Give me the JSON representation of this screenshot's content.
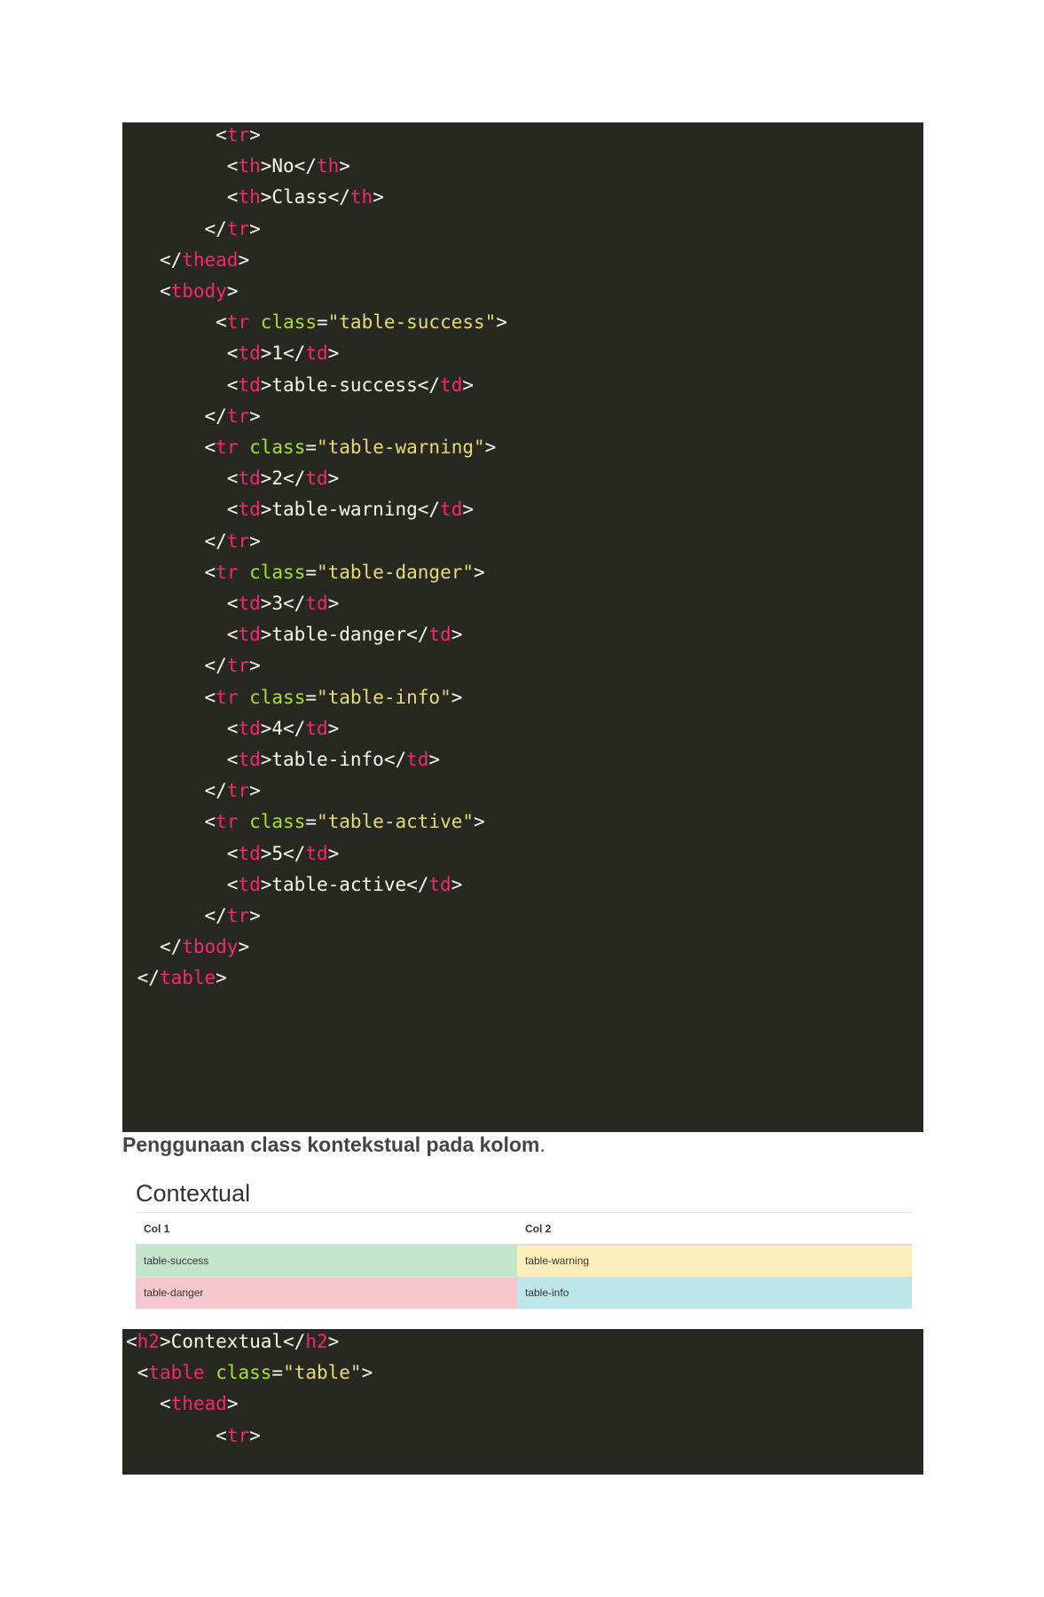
{
  "code_top": [
    {
      "indent": "        ",
      "tokens": [
        [
          "p",
          "<"
        ],
        [
          "t",
          "tr"
        ],
        [
          "p",
          ">"
        ]
      ]
    },
    {
      "indent": "         ",
      "tokens": [
        [
          "p",
          "<"
        ],
        [
          "t",
          "th"
        ],
        [
          "p",
          ">No</"
        ],
        [
          "t",
          "th"
        ],
        [
          "p",
          ">"
        ]
      ]
    },
    {
      "indent": "         ",
      "tokens": [
        [
          "p",
          "<"
        ],
        [
          "t",
          "th"
        ],
        [
          "p",
          ">Class</"
        ],
        [
          "t",
          "th"
        ],
        [
          "p",
          ">"
        ]
      ]
    },
    {
      "indent": "       ",
      "tokens": [
        [
          "p",
          "</"
        ],
        [
          "t",
          "tr"
        ],
        [
          "p",
          ">"
        ]
      ]
    },
    {
      "indent": "   ",
      "tokens": [
        [
          "p",
          "</"
        ],
        [
          "t",
          "thead"
        ],
        [
          "p",
          ">"
        ]
      ]
    },
    {
      "indent": "   ",
      "tokens": [
        [
          "p",
          "<"
        ],
        [
          "t",
          "tbody"
        ],
        [
          "p",
          ">"
        ]
      ]
    },
    {
      "indent": "        ",
      "tokens": [
        [
          "p",
          "<"
        ],
        [
          "t",
          "tr"
        ],
        [
          "p",
          " "
        ],
        [
          "a",
          "class"
        ],
        [
          "p",
          "="
        ],
        [
          "s",
          "\"table-success\""
        ],
        [
          "p",
          ">"
        ]
      ]
    },
    {
      "indent": "         ",
      "tokens": [
        [
          "p",
          "<"
        ],
        [
          "t",
          "td"
        ],
        [
          "p",
          ">1</"
        ],
        [
          "t",
          "td"
        ],
        [
          "p",
          ">"
        ]
      ]
    },
    {
      "indent": "         ",
      "tokens": [
        [
          "p",
          "<"
        ],
        [
          "t",
          "td"
        ],
        [
          "p",
          ">table-success</"
        ],
        [
          "t",
          "td"
        ],
        [
          "p",
          ">"
        ]
      ]
    },
    {
      "indent": "       ",
      "tokens": [
        [
          "p",
          "</"
        ],
        [
          "t",
          "tr"
        ],
        [
          "p",
          ">"
        ]
      ]
    },
    {
      "indent": "       ",
      "tokens": [
        [
          "p",
          "<"
        ],
        [
          "t",
          "tr"
        ],
        [
          "p",
          " "
        ],
        [
          "a",
          "class"
        ],
        [
          "p",
          "="
        ],
        [
          "s",
          "\"table-warning\""
        ],
        [
          "p",
          ">"
        ]
      ]
    },
    {
      "indent": "         ",
      "tokens": [
        [
          "p",
          "<"
        ],
        [
          "t",
          "td"
        ],
        [
          "p",
          ">2</"
        ],
        [
          "t",
          "td"
        ],
        [
          "p",
          ">"
        ]
      ]
    },
    {
      "indent": "         ",
      "tokens": [
        [
          "p",
          "<"
        ],
        [
          "t",
          "td"
        ],
        [
          "p",
          ">table-warning</"
        ],
        [
          "t",
          "td"
        ],
        [
          "p",
          ">"
        ]
      ]
    },
    {
      "indent": "       ",
      "tokens": [
        [
          "p",
          "</"
        ],
        [
          "t",
          "tr"
        ],
        [
          "p",
          ">"
        ]
      ]
    },
    {
      "indent": "       ",
      "tokens": [
        [
          "p",
          "<"
        ],
        [
          "t",
          "tr"
        ],
        [
          "p",
          " "
        ],
        [
          "a",
          "class"
        ],
        [
          "p",
          "="
        ],
        [
          "s",
          "\"table-danger\""
        ],
        [
          "p",
          ">"
        ]
      ]
    },
    {
      "indent": "         ",
      "tokens": [
        [
          "p",
          "<"
        ],
        [
          "t",
          "td"
        ],
        [
          "p",
          ">3</"
        ],
        [
          "t",
          "td"
        ],
        [
          "p",
          ">"
        ]
      ]
    },
    {
      "indent": "         ",
      "tokens": [
        [
          "p",
          "<"
        ],
        [
          "t",
          "td"
        ],
        [
          "p",
          ">table-danger</"
        ],
        [
          "t",
          "td"
        ],
        [
          "p",
          ">"
        ]
      ]
    },
    {
      "indent": "       ",
      "tokens": [
        [
          "p",
          "</"
        ],
        [
          "t",
          "tr"
        ],
        [
          "p",
          ">"
        ]
      ]
    },
    {
      "indent": "       ",
      "tokens": [
        [
          "p",
          "<"
        ],
        [
          "t",
          "tr"
        ],
        [
          "p",
          " "
        ],
        [
          "a",
          "class"
        ],
        [
          "p",
          "="
        ],
        [
          "s",
          "\"table-info\""
        ],
        [
          "p",
          ">"
        ]
      ]
    },
    {
      "indent": "         ",
      "tokens": [
        [
          "p",
          "<"
        ],
        [
          "t",
          "td"
        ],
        [
          "p",
          ">4</"
        ],
        [
          "t",
          "td"
        ],
        [
          "p",
          ">"
        ]
      ]
    },
    {
      "indent": "         ",
      "tokens": [
        [
          "p",
          "<"
        ],
        [
          "t",
          "td"
        ],
        [
          "p",
          ">table-info</"
        ],
        [
          "t",
          "td"
        ],
        [
          "p",
          ">"
        ]
      ]
    },
    {
      "indent": "       ",
      "tokens": [
        [
          "p",
          "</"
        ],
        [
          "t",
          "tr"
        ],
        [
          "p",
          ">"
        ]
      ]
    },
    {
      "indent": "       ",
      "tokens": [
        [
          "p",
          "<"
        ],
        [
          "t",
          "tr"
        ],
        [
          "p",
          " "
        ],
        [
          "a",
          "class"
        ],
        [
          "p",
          "="
        ],
        [
          "s",
          "\"table-active\""
        ],
        [
          "p",
          ">"
        ]
      ]
    },
    {
      "indent": "         ",
      "tokens": [
        [
          "p",
          "<"
        ],
        [
          "t",
          "td"
        ],
        [
          "p",
          ">5</"
        ],
        [
          "t",
          "td"
        ],
        [
          "p",
          ">"
        ]
      ]
    },
    {
      "indent": "         ",
      "tokens": [
        [
          "p",
          "<"
        ],
        [
          "t",
          "td"
        ],
        [
          "p",
          ">table-active</"
        ],
        [
          "t",
          "td"
        ],
        [
          "p",
          ">"
        ]
      ]
    },
    {
      "indent": "       ",
      "tokens": [
        [
          "p",
          "</"
        ],
        [
          "t",
          "tr"
        ],
        [
          "p",
          ">"
        ]
      ]
    },
    {
      "indent": "   ",
      "tokens": [
        [
          "p",
          "</"
        ],
        [
          "t",
          "tbody"
        ],
        [
          "p",
          ">"
        ]
      ]
    },
    {
      "indent": " ",
      "tokens": [
        [
          "p",
          "</"
        ],
        [
          "t",
          "table"
        ],
        [
          "p",
          ">"
        ]
      ]
    }
  ],
  "caption": {
    "bold": "Penggunaan class kontekstual pada kolom",
    "tail": "."
  },
  "demo": {
    "title": "Contextual",
    "headers": [
      "Col 1",
      "Col 2"
    ],
    "rows": [
      [
        {
          "text": "table-success",
          "color": "#c3e6cb"
        },
        {
          "text": "table-warning",
          "color": "#ffeeba"
        }
      ],
      [
        {
          "text": "table-danger",
          "color": "#f5c6cb"
        },
        {
          "text": "table-info",
          "color": "#bee5eb"
        }
      ]
    ]
  },
  "code_bottom": [
    {
      "indent": "",
      "tokens": [
        [
          "p",
          "<"
        ],
        [
          "t",
          "h2"
        ],
        [
          "p",
          ">Contextual</"
        ],
        [
          "t",
          "h2"
        ],
        [
          "p",
          ">"
        ]
      ]
    },
    {
      "indent": " ",
      "tokens": [
        [
          "p",
          "<"
        ],
        [
          "t",
          "table"
        ],
        [
          "p",
          " "
        ],
        [
          "a",
          "class"
        ],
        [
          "p",
          "="
        ],
        [
          "s",
          "\"table\""
        ],
        [
          "p",
          ">"
        ]
      ]
    },
    {
      "indent": "   ",
      "tokens": [
        [
          "p",
          "<"
        ],
        [
          "t",
          "thead"
        ],
        [
          "p",
          ">"
        ]
      ]
    },
    {
      "indent": "        ",
      "tokens": [
        [
          "p",
          "<"
        ],
        [
          "t",
          "tr"
        ],
        [
          "p",
          ">"
        ]
      ]
    }
  ],
  "colors": {
    "code_bg": "#272822",
    "tag": "#f92672",
    "attr": "#a6e22e",
    "string": "#e6db74",
    "text": "#f8f8f2"
  }
}
